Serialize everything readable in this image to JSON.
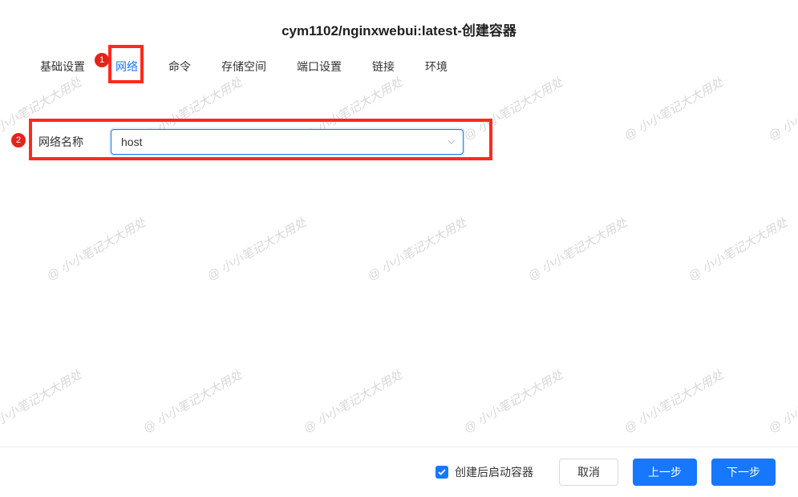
{
  "watermark_text": "@ 小小笔记大大用处",
  "header": {
    "title": "cym1102/nginxwebui:latest-创建容器"
  },
  "tabs": [
    {
      "label": "基础设置",
      "active": false
    },
    {
      "label": "网络",
      "active": true
    },
    {
      "label": "命令",
      "active": false
    },
    {
      "label": "存储空间",
      "active": false
    },
    {
      "label": "端口设置",
      "active": false
    },
    {
      "label": "链接",
      "active": false
    },
    {
      "label": "环境",
      "active": false
    }
  ],
  "form": {
    "network_name_label": "网络名称",
    "network_name_value": "host"
  },
  "footer": {
    "start_after_create_label": "创建后启动容器",
    "start_after_create_checked": true,
    "cancel_label": "取消",
    "prev_label": "上一步",
    "next_label": "下一步"
  },
  "annotations": {
    "marker1": "1",
    "marker2": "2"
  }
}
